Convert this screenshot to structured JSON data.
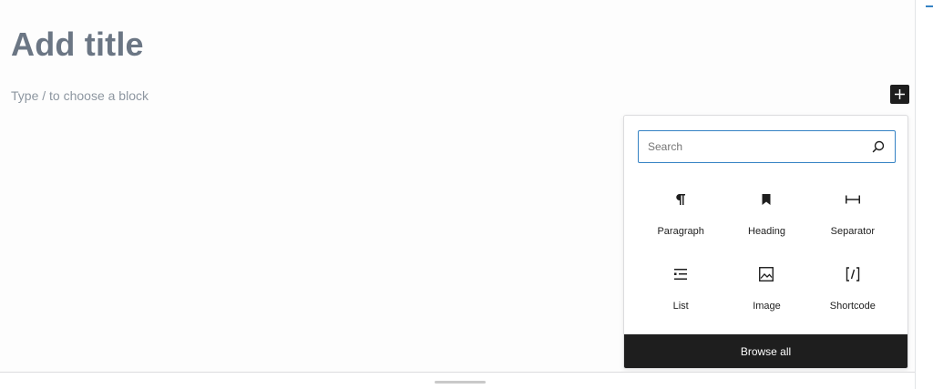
{
  "editor": {
    "title_placeholder": "Add title",
    "block_placeholder": "Type / to choose a block"
  },
  "inserter": {
    "toggle_icon": "plus-icon",
    "search": {
      "placeholder": "Search",
      "value": "",
      "icon": "search-icon"
    },
    "blocks": [
      {
        "label": "Paragraph",
        "icon": "paragraph-icon"
      },
      {
        "label": "Heading",
        "icon": "bookmark-icon"
      },
      {
        "label": "Separator",
        "icon": "separator-icon"
      },
      {
        "label": "List",
        "icon": "list-icon"
      },
      {
        "label": "Image",
        "icon": "image-icon"
      },
      {
        "label": "Shortcode",
        "icon": "shortcode-icon"
      }
    ],
    "browse_all_label": "Browse all"
  },
  "colors": {
    "accent": "#3582c4",
    "dark": "#1e1e1e",
    "title": "#6b7684",
    "placeholder": "#8d96a0"
  }
}
